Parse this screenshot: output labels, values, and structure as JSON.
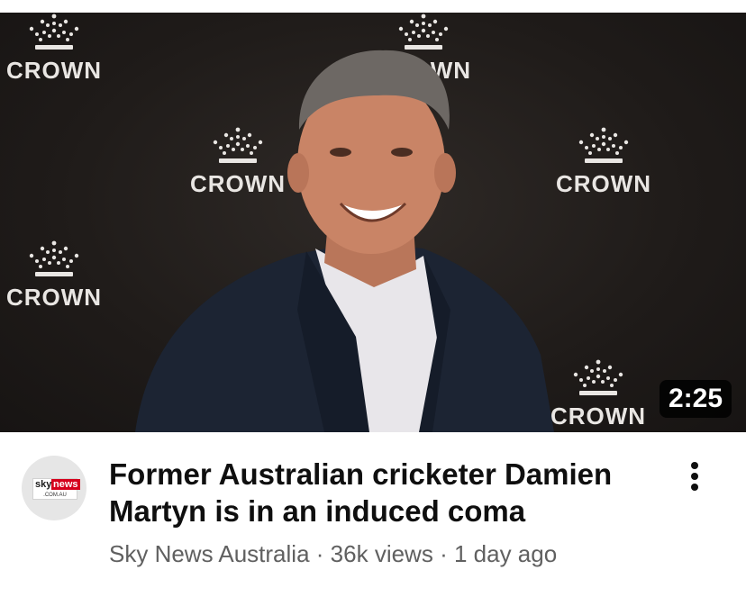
{
  "video": {
    "duration": "2:25",
    "backdrop_word": "CROWN",
    "title": "Former Australian cricketer Damien Martyn is in an induced coma",
    "channel": "Sky News Australia",
    "separator": "·",
    "views": "36k views",
    "age": "1 day ago"
  },
  "channel_avatar": {
    "logo_sky": "sky",
    "logo_news": "news",
    "logo_domain": ".COM.AU"
  },
  "icons": {
    "menu": "more-vert-icon",
    "crown": "crown-logo-icon"
  },
  "colors": {
    "title": "#0f0f0f",
    "meta_text": "#606060",
    "duration_bg": "#000000",
    "sky_red": "#d5001c"
  }
}
